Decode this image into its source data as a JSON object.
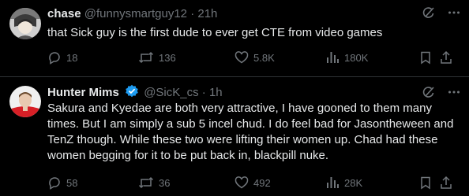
{
  "tweets": [
    {
      "name": "chase",
      "handle": "@funnysmartguy12",
      "dot": "·",
      "time": "21h",
      "text": "that Sick guy is the first dude to ever get CTE from video games",
      "stats": {
        "replies": "18",
        "reposts": "136",
        "likes": "5.8K",
        "views": "180K"
      }
    },
    {
      "name": "Hunter Mims",
      "handle": "@SicK_cs",
      "dot": "·",
      "time": "1h",
      "text": "Sakura and Kyedae are both very attractive, I have gooned to them many times. But I am simply a sub 5 incel chud. I do feel bad for Jasontheween and TenZ though. While these two were lifting their women up. Chad had these women begging for it to be put back in, blackpill nuke.",
      "stats": {
        "replies": "58",
        "reposts": "36",
        "likes": "492",
        "views": "28K"
      }
    }
  ],
  "colors": {
    "text": "#e7e9ea",
    "muted": "#71767b",
    "verified": "#1d9bf0",
    "divider": "#2f3336",
    "background": "#000000"
  },
  "icons": [
    "grok-icon",
    "more-icon",
    "reply-icon",
    "repost-icon",
    "like-icon",
    "views-icon",
    "bookmark-icon",
    "share-icon",
    "verified-badge-icon"
  ]
}
